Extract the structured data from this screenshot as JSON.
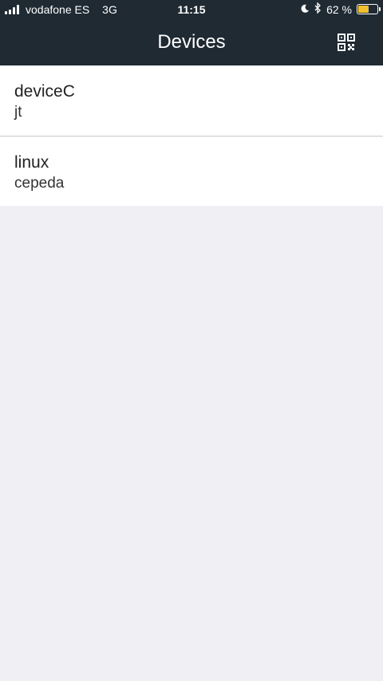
{
  "status_bar": {
    "carrier": "vodafone ES",
    "network": "3G",
    "time": "11:15",
    "battery_text": "62 %",
    "battery_level": 0.62,
    "icons": [
      "signal-icon",
      "moon-icon",
      "bluetooth-icon",
      "battery-icon"
    ]
  },
  "header": {
    "title": "Devices",
    "qr_icon": "qr-code-icon",
    "background": "#1f2a33"
  },
  "devices": [
    {
      "name": "deviceC",
      "user": "jt"
    },
    {
      "name": "linux",
      "user": "cepeda"
    }
  ],
  "colors": {
    "page_background": "#efeff4",
    "battery_fill": "#f2c12e"
  }
}
